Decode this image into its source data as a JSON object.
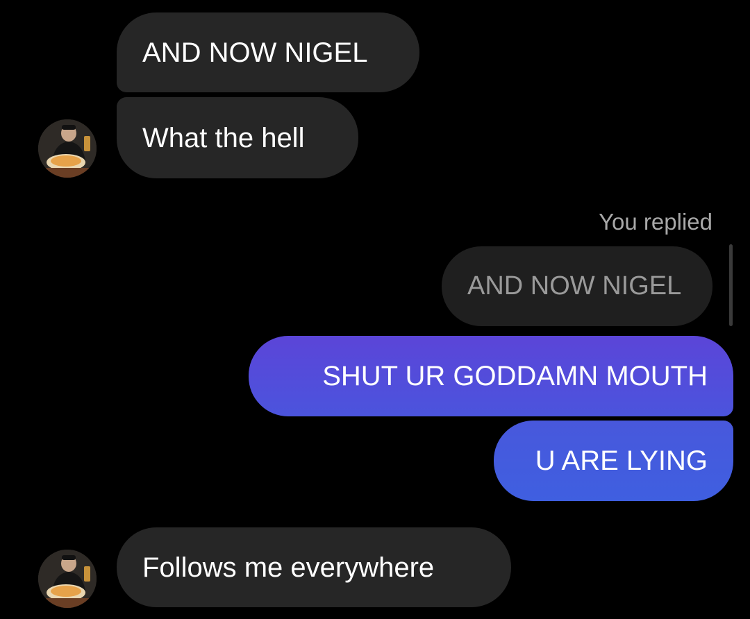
{
  "messages": {
    "m1": "AND NOW NIGEL",
    "m2": "What the hell",
    "reply_label": "You replied",
    "quoted": "AND NOW NIGEL",
    "m3": "SHUT UR GODDAMN MOUTH",
    "m4": "U ARE LYING",
    "m5": "Follows me everywhere"
  },
  "colors": {
    "incoming_bubble": "#262626",
    "outgoing_gradient_top": "#5b45d8",
    "outgoing_gradient_bottom": "#3f5fe0",
    "background": "#000000"
  }
}
